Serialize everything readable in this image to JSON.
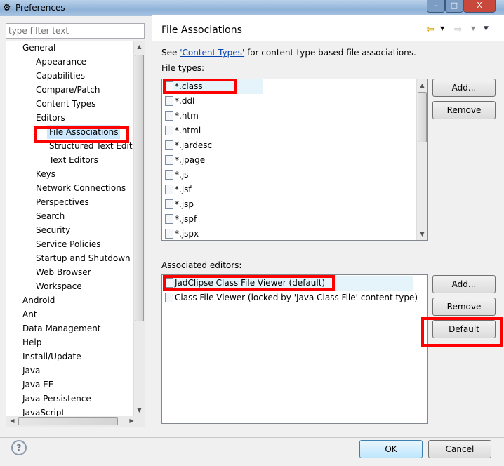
{
  "window": {
    "title": "Preferences"
  },
  "filter": {
    "placeholder": "type filter text"
  },
  "tree": [
    {
      "label": "General",
      "level": 0
    },
    {
      "label": "Appearance",
      "level": 1
    },
    {
      "label": "Capabilities",
      "level": 1
    },
    {
      "label": "Compare/Patch",
      "level": 1
    },
    {
      "label": "Content Types",
      "level": 1
    },
    {
      "label": "Editors",
      "level": 1
    },
    {
      "label": "File Associations",
      "level": 2,
      "selected": true
    },
    {
      "label": "Structured Text Edito",
      "level": 2
    },
    {
      "label": "Text Editors",
      "level": 2
    },
    {
      "label": "Keys",
      "level": 1
    },
    {
      "label": "Network Connections",
      "level": 1
    },
    {
      "label": "Perspectives",
      "level": 1
    },
    {
      "label": "Search",
      "level": 1
    },
    {
      "label": "Security",
      "level": 1
    },
    {
      "label": "Service Policies",
      "level": 1
    },
    {
      "label": "Startup and Shutdown",
      "level": 1
    },
    {
      "label": "Web Browser",
      "level": 1
    },
    {
      "label": "Workspace",
      "level": 1
    },
    {
      "label": "Android",
      "level": 0
    },
    {
      "label": "Ant",
      "level": 0
    },
    {
      "label": "Data Management",
      "level": 0
    },
    {
      "label": "Help",
      "level": 0
    },
    {
      "label": "Install/Update",
      "level": 0
    },
    {
      "label": "Java",
      "level": 0
    },
    {
      "label": "Java EE",
      "level": 0
    },
    {
      "label": "Java Persistence",
      "level": 0
    },
    {
      "label": "JavaScript",
      "level": 0
    }
  ],
  "page": {
    "title": "File Associations",
    "desc_pre": "See ",
    "desc_link": "'Content Types'",
    "desc_post": " for content-type based file associations.",
    "file_types_label": "File types:",
    "file_types": [
      "*.class",
      "*.ddl",
      "*.htm",
      "*.html",
      "*.jardesc",
      "*.jpage",
      "*.js",
      "*.jsf",
      "*.jsp",
      "*.jspf",
      "*.jspx"
    ],
    "assoc_label": "Associated editors:",
    "editors": [
      "JadClipse Class File Viewer (default)",
      "Class File Viewer (locked by 'Java Class File' content type)"
    ],
    "add_label": "Add...",
    "remove_label": "Remove",
    "default_label": "Default"
  },
  "footer": {
    "ok": "OK",
    "cancel": "Cancel"
  },
  "colors": {
    "highlight": "#ff0000",
    "link": "#0645ad"
  }
}
